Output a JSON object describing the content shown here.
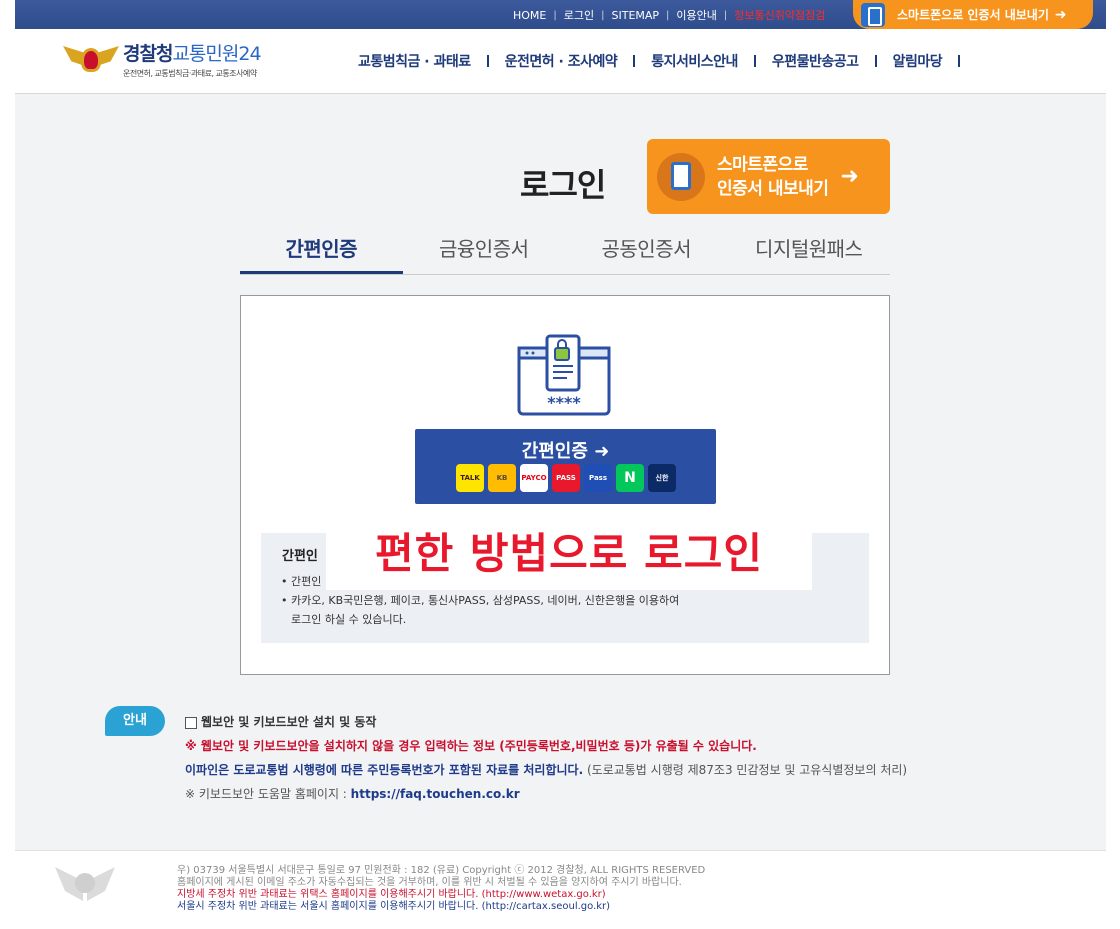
{
  "topbar": {
    "links": [
      "HOME",
      "로그인",
      "SITEMAP",
      "이용안내"
    ],
    "red_link": "정보통신취약점점검",
    "export_pill": "스마트폰으로 인증서 내보내기"
  },
  "header": {
    "logo_title_a": "경찰청",
    "logo_title_b": "교통민원24",
    "logo_sub": "운전면허, 교통범칙금·과태료, 교통조사예약",
    "nav": [
      "교통범칙금 · 과태료",
      "운전면허 · 조사예약",
      "통지서비스안내",
      "우편물반송공고",
      "알림마당"
    ]
  },
  "main": {
    "title": "로그인",
    "export_line1": "스마트폰으로",
    "export_line2": "인증서 내보내기",
    "tabs": [
      "간편인증",
      "금융인증서",
      "공동인증서",
      "디지털원패스"
    ],
    "active_tab": 0,
    "auth_button": "간편인증",
    "providers": [
      {
        "label": "TALK",
        "bg": "#fee500",
        "fg": "#3c1e1e"
      },
      {
        "label": "KB",
        "bg": "#ffbc00",
        "fg": "#594a3a"
      },
      {
        "label": "PAYCO",
        "bg": "#fff",
        "fg": "#e60012"
      },
      {
        "label": "PASS",
        "bg": "#e8192c",
        "fg": "#fff"
      },
      {
        "label": "Pass",
        "bg": "#1f4fb5",
        "fg": "#fff"
      },
      {
        "label": "N",
        "bg": "#03c75a",
        "fg": "#fff"
      },
      {
        "label": "신한",
        "bg": "#0b2a66",
        "fg": "#fff"
      }
    ],
    "info_title": "간편인",
    "info_title_end": ")",
    "info_items": [
      "간편인",
      "카카오, KB국민은행, 페이코, 통신사PASS, 삼성PASS, 네이버, 신한은행을 이용하여",
      "로그인 하실 수 있습니다."
    ],
    "overlay": "편한 방법으로 로그인"
  },
  "notice": {
    "badge": "안내",
    "checkbox_label": "웹보안 및 키보드보안 설치 및 동작",
    "warning": "※ 웹보안 및 키보드보안을 설치하지 않을 경우 입력하는 정보 (주민등록번호,비밀번호 등)가 유출될 수 있습니다.",
    "law": "이파인은 도로교통법 시행령에 따른 주민등록번호가 포함된 자료를 처리합니다.",
    "law_note": "(도로교통법 시행령 제87조3 민감정보 및 고유식별정보의 처리)",
    "help_prefix": "※ 키보드보안 도움말 홈페이지 :",
    "help_link": "https://faq.touchen.co.kr"
  },
  "footer": {
    "line1": "우) 03739 서울특별시 서대문구 통일로 97  민원전화 : 182 (유료)       Copyright ⓒ 2012 경찰청, ALL RIGHTS RESERVED",
    "line2": "홈페이지에 게시된 이메일 주소가 자동수집되는 것을 거부하며, 이를 위반 시 처벌될 수 있음을 양지하여 주시기 바랍니다.",
    "line3": "지방세 주정차 위반 과태료는 위택스 홈페이지를 이용해주시기 바랍니다. (http://www.wetax.go.kr)",
    "line4": "서울시 주정차 위반 과태료는 서울시 홈페이지를 이용해주시기 바랍니다. (http://cartax.seoul.go.kr)"
  }
}
